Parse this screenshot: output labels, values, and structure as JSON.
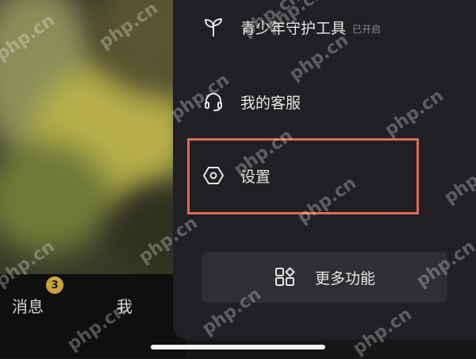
{
  "watermark": "php.cn",
  "menu": {
    "items": [
      {
        "label": "青少年守护工具",
        "sub": "已开启",
        "icon": "sprout-icon"
      },
      {
        "label": "我的客服",
        "icon": "headset-icon"
      },
      {
        "label": "设置",
        "icon": "settings-hexagon-icon"
      }
    ],
    "more_label": "更多功能",
    "more_icon": "grid-apps-icon"
  },
  "bottom_tabs": {
    "messages": "消息",
    "messages_badge": "3",
    "me": "我"
  },
  "colors": {
    "highlight": "#e06a50",
    "badge": "#c9a23a",
    "drawer": "#202024"
  }
}
